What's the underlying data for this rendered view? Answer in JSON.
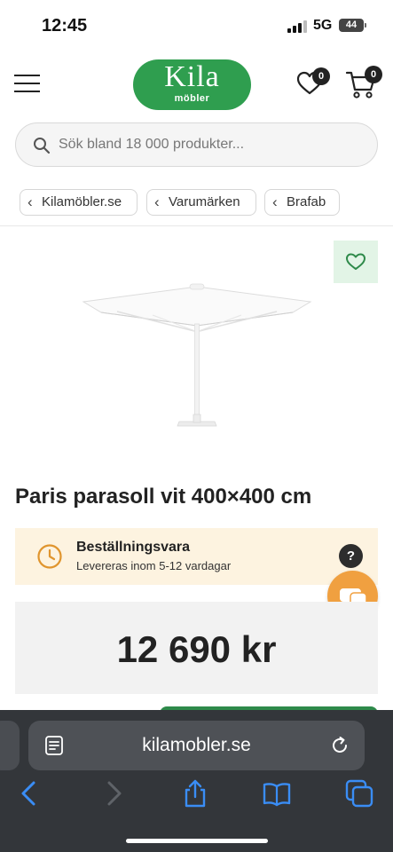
{
  "status_bar": {
    "time": "12:45",
    "network": "5G",
    "battery": "44"
  },
  "header": {
    "logo_main": "Kila",
    "logo_sub": "möbler",
    "wishlist_count": "0",
    "cart_count": "0"
  },
  "search": {
    "placeholder": "Sök bland 18 000 produkter..."
  },
  "breadcrumbs": [
    {
      "label": "Kilamöbler.se"
    },
    {
      "label": "Varumärken"
    },
    {
      "label": "Brafab"
    }
  ],
  "product": {
    "title": "Paris parasoll vit 400×400 cm",
    "delivery_title": "Beställningsvara",
    "delivery_subtitle": "Levereras inom 5-12 vardagar",
    "price": "12 690 kr",
    "help_label": "?"
  },
  "browser": {
    "url": "kilamobler.se"
  },
  "colors": {
    "brand_green": "#2f9e4f",
    "fav_bg": "#e2f4e6",
    "delivery_bg": "#fdf3e0",
    "chat_orange": "#f0a040",
    "toolbar_blue": "#3a8df5"
  },
  "icons": {
    "menu": "hamburger-menu-icon",
    "wishlist": "heart-icon",
    "cart": "shopping-cart-icon",
    "search": "search-icon",
    "back": "chevron-left-icon",
    "delivery": "clock-icon",
    "chat": "chat-bubbles-icon",
    "reader": "reader-icon",
    "reload": "reload-icon",
    "share": "share-icon",
    "bookmarks": "book-icon",
    "tabs": "tabs-icon"
  }
}
